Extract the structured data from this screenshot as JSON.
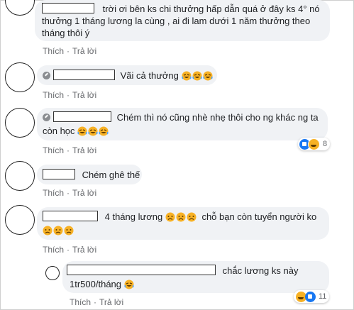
{
  "actions": {
    "like": "Thích",
    "reply": "Trả lời",
    "sep": "·"
  },
  "comments": [
    {
      "line1": "trời ơi bên ks chi thưởng hấp dẫn quá ở đây ks 4° nó",
      "line2": "thưởng 1 tháng lương la cùng , ai đi lam dưới 1 năm thưởng theo",
      "line3": "tháng thôi ý"
    },
    {
      "text": "Vãi cả thưởng"
    },
    {
      "line1": "Chém thì nó cũng nhè nhẹ thôi cho ng khác ng ta",
      "line2": "còn học",
      "reaction_count": "8"
    },
    {
      "text": "Chém ghê thế"
    },
    {
      "line1": "4 tháng lương",
      "line1b": "chỗ bạn còn tuyển người ko"
    },
    {
      "line1": "chắc lương ks này",
      "line2": "1tr500/tháng",
      "reaction_count": "11"
    }
  ]
}
